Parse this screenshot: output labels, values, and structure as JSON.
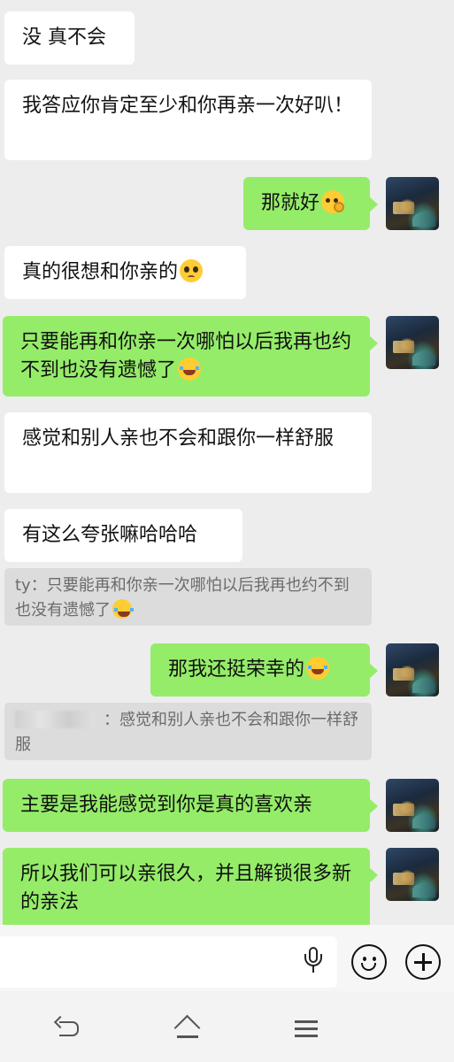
{
  "messages": [
    {
      "side": "left",
      "text": "没 真不会"
    },
    {
      "side": "left",
      "text": "我答应你肯定至少和你再亲一次好叭！"
    },
    {
      "side": "right",
      "text": "那就好",
      "emoji": "ok-face"
    },
    {
      "side": "left",
      "text": "真的很想和你亲的",
      "emoji": "pleading-face"
    },
    {
      "side": "right",
      "text": "只要能再和你亲一次哪怕以后我再也约不到也没有遗憾了",
      "emoji": "tears-of-joy"
    },
    {
      "side": "left",
      "text": "感觉和别人亲也不会和跟你一样舒服"
    },
    {
      "side": "left",
      "text": "有这么夸张嘛哈哈哈"
    },
    {
      "side": "left-quote",
      "text": "ty：只要能再和你亲一次哪怕以后我再也约不到也没有遗憾了",
      "emoji": "tears-of-joy"
    },
    {
      "side": "right",
      "text": "那我还挺荣幸的",
      "emoji": "tears-of-joy"
    },
    {
      "side": "right-quote",
      "text": "：感觉和别人亲也不会和跟你一样舒服"
    },
    {
      "side": "right",
      "text": "主要是我能感觉到你是真的喜欢亲"
    },
    {
      "side": "right",
      "text": "所以我们可以亲很久，并且解锁很多新的亲法"
    }
  ],
  "colors": {
    "background": "#ededed",
    "self_bubble": "#95ec69",
    "other_bubble": "#ffffff",
    "quote": "#dcdcdc"
  },
  "icons": [
    "voice-icon",
    "emoji-icon",
    "plus-icon",
    "back-icon",
    "home-icon",
    "menu-icon"
  ]
}
